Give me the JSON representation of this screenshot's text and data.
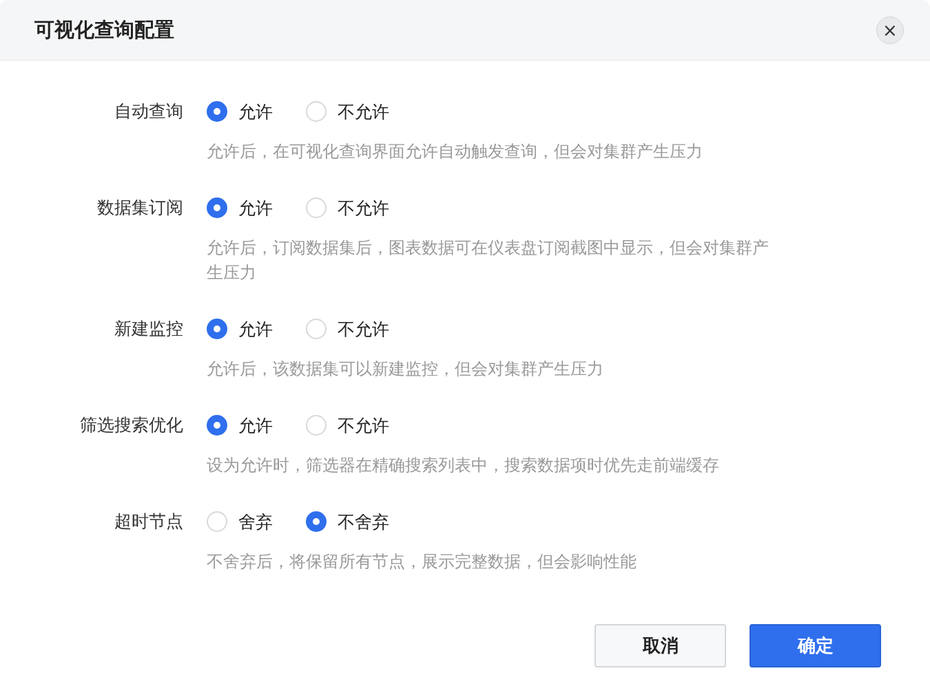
{
  "dialog": {
    "title": "可视化查询配置",
    "close_icon": "×"
  },
  "settings": [
    {
      "label": "自动查询",
      "options": [
        {
          "label": "允许",
          "selected": true
        },
        {
          "label": "不允许",
          "selected": false
        }
      ],
      "description": "允许后，在可视化查询界面允许自动触发查询，但会对集群产生压力"
    },
    {
      "label": "数据集订阅",
      "options": [
        {
          "label": "允许",
          "selected": true
        },
        {
          "label": "不允许",
          "selected": false
        }
      ],
      "description": "允许后，订阅数据集后，图表数据可在仪表盘订阅截图中显示，但会对集群产生压力"
    },
    {
      "label": "新建监控",
      "options": [
        {
          "label": "允许",
          "selected": true
        },
        {
          "label": "不允许",
          "selected": false
        }
      ],
      "description": "允许后，该数据集可以新建监控，但会对集群产生压力"
    },
    {
      "label": "筛选搜索优化",
      "options": [
        {
          "label": "允许",
          "selected": true
        },
        {
          "label": "不允许",
          "selected": false
        }
      ],
      "description": "设为允许时，筛选器在精确搜索列表中，搜索数据项时优先走前端缓存"
    },
    {
      "label": "超时节点",
      "options": [
        {
          "label": "舍弃",
          "selected": false
        },
        {
          "label": "不舍弃",
          "selected": true
        }
      ],
      "description": "不舍弃后，将保留所有节点，展示完整数据，但会影响性能"
    }
  ],
  "buttons": [
    {
      "label": "取消",
      "kind": "secondary"
    },
    {
      "label": "确定",
      "kind": "primary"
    }
  ]
}
